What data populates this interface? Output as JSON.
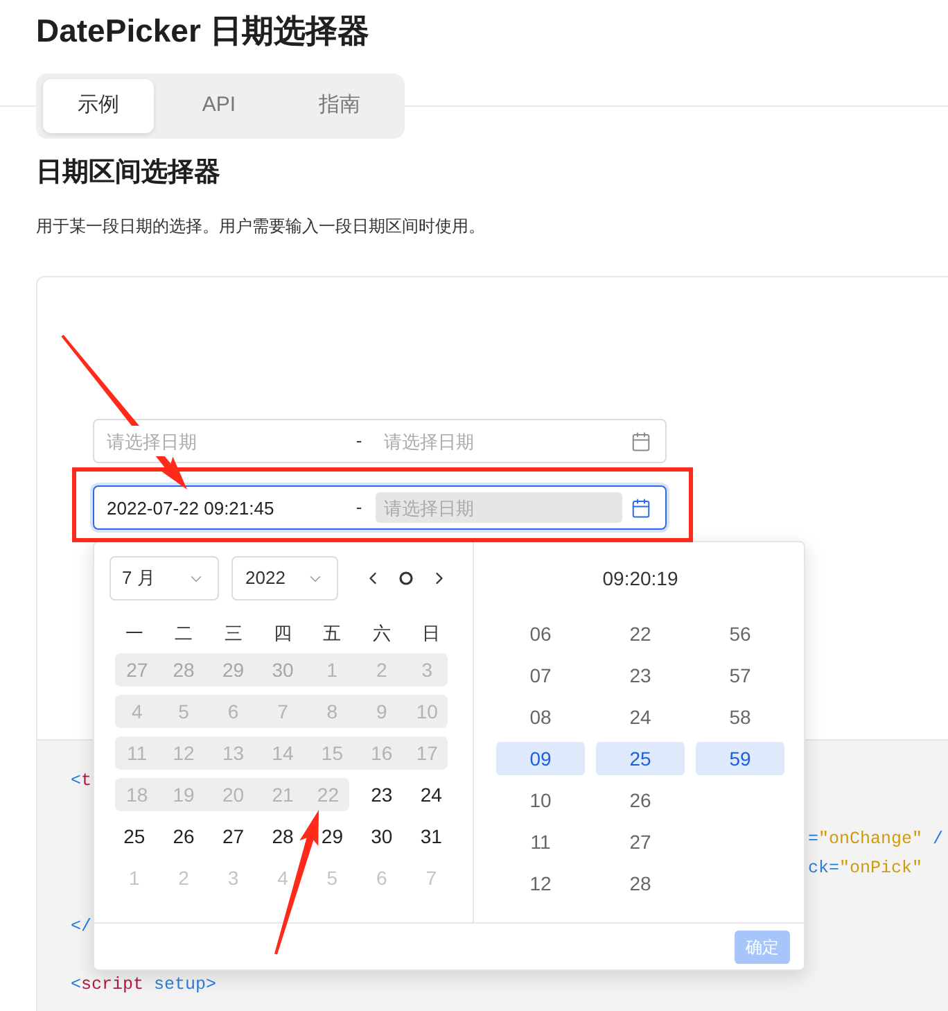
{
  "page": {
    "title": "DatePicker 日期选择器"
  },
  "tabs": [
    {
      "label": "示例",
      "selected": true
    },
    {
      "label": "API",
      "selected": false
    },
    {
      "label": "指南",
      "selected": false
    }
  ],
  "section": {
    "heading": "日期区间选择器",
    "description": "用于某一段日期的选择。用户需要输入一段日期区间时使用。"
  },
  "demo": {
    "range_pickers": [
      {
        "start": {
          "placeholder": "请选择日期",
          "active": false
        },
        "separator": "-",
        "end": {
          "placeholder": "请选择日期",
          "active": false
        },
        "focused": false,
        "highlighted": false
      },
      {
        "start": {
          "value": "2022-07-22 09:21:45",
          "active": false
        },
        "separator": "-",
        "end": {
          "placeholder": "请选择日期",
          "active": true
        },
        "focused": true,
        "highlighted": true
      }
    ],
    "popup": {
      "month_select": {
        "value": "7 月"
      },
      "year_select": {
        "value": "2022"
      },
      "weekdays": [
        "一",
        "二",
        "三",
        "四",
        "五",
        "六",
        "日"
      ],
      "weeks": [
        {
          "days": [
            {
              "label": "27",
              "disabled": true,
              "other_month": true
            },
            {
              "label": "28",
              "disabled": true,
              "other_month": true
            },
            {
              "label": "29",
              "disabled": true,
              "other_month": true
            },
            {
              "label": "30",
              "disabled": true,
              "other_month": true
            },
            {
              "label": "1",
              "disabled": true,
              "other_month": false
            },
            {
              "label": "2",
              "disabled": true,
              "other_month": false
            },
            {
              "label": "3",
              "disabled": true,
              "other_month": false
            }
          ]
        },
        {
          "days": [
            {
              "label": "4",
              "disabled": true,
              "other_month": false
            },
            {
              "label": "5",
              "disabled": true,
              "other_month": false
            },
            {
              "label": "6",
              "disabled": true,
              "other_month": false
            },
            {
              "label": "7",
              "disabled": true,
              "other_month": false
            },
            {
              "label": "8",
              "disabled": true,
              "other_month": false
            },
            {
              "label": "9",
              "disabled": true,
              "other_month": false
            },
            {
              "label": "10",
              "disabled": true,
              "other_month": false
            }
          ]
        },
        {
          "days": [
            {
              "label": "11",
              "disabled": true,
              "other_month": false
            },
            {
              "label": "12",
              "disabled": true,
              "other_month": false
            },
            {
              "label": "13",
              "disabled": true,
              "other_month": false
            },
            {
              "label": "14",
              "disabled": true,
              "other_month": false
            },
            {
              "label": "15",
              "disabled": true,
              "other_month": false
            },
            {
              "label": "16",
              "disabled": true,
              "other_month": false
            },
            {
              "label": "17",
              "disabled": true,
              "other_month": false
            }
          ]
        },
        {
          "days": [
            {
              "label": "18",
              "disabled": true,
              "other_month": false
            },
            {
              "label": "19",
              "disabled": true,
              "other_month": false
            },
            {
              "label": "20",
              "disabled": true,
              "other_month": false
            },
            {
              "label": "21",
              "disabled": true,
              "other_month": false
            },
            {
              "label": "22",
              "disabled": true,
              "other_month": false
            },
            {
              "label": "23",
              "disabled": false,
              "other_month": false
            },
            {
              "label": "24",
              "disabled": false,
              "other_month": false
            }
          ]
        },
        {
          "days": [
            {
              "label": "25",
              "disabled": false,
              "other_month": false
            },
            {
              "label": "26",
              "disabled": false,
              "other_month": false
            },
            {
              "label": "27",
              "disabled": false,
              "other_month": false
            },
            {
              "label": "28",
              "disabled": false,
              "other_month": false
            },
            {
              "label": "29",
              "disabled": false,
              "other_month": false
            },
            {
              "label": "30",
              "disabled": false,
              "other_month": false
            },
            {
              "label": "31",
              "disabled": false,
              "other_month": false
            }
          ]
        },
        {
          "days": [
            {
              "label": "1",
              "disabled": false,
              "other_month": true
            },
            {
              "label": "2",
              "disabled": false,
              "other_month": true
            },
            {
              "label": "3",
              "disabled": false,
              "other_month": true
            },
            {
              "label": "4",
              "disabled": false,
              "other_month": true
            },
            {
              "label": "5",
              "disabled": false,
              "other_month": true
            },
            {
              "label": "6",
              "disabled": false,
              "other_month": true
            },
            {
              "label": "7",
              "disabled": false,
              "other_month": true
            }
          ]
        }
      ],
      "time_panel": {
        "title": "09:20:19",
        "columns": [
          {
            "items": [
              {
                "label": "06",
                "selected": false
              },
              {
                "label": "07",
                "selected": false
              },
              {
                "label": "08",
                "selected": false
              },
              {
                "label": "09",
                "selected": true
              },
              {
                "label": "10",
                "selected": false
              },
              {
                "label": "11",
                "selected": false
              },
              {
                "label": "12",
                "selected": false
              }
            ]
          },
          {
            "items": [
              {
                "label": "22",
                "selected": false
              },
              {
                "label": "23",
                "selected": false
              },
              {
                "label": "24",
                "selected": false
              },
              {
                "label": "25",
                "selected": true
              },
              {
                "label": "26",
                "selected": false
              },
              {
                "label": "27",
                "selected": false
              },
              {
                "label": "28",
                "selected": false
              }
            ]
          },
          {
            "items": [
              {
                "label": "56",
                "selected": false
              },
              {
                "label": "57",
                "selected": false
              },
              {
                "label": "58",
                "selected": false
              },
              {
                "label": "59",
                "selected": true
              }
            ]
          }
        ]
      },
      "confirm_button": {
        "label": "确定",
        "disabled": true
      }
    }
  },
  "code": {
    "lines": [
      {
        "kind": "left_fragment",
        "tokens": [
          {
            "kind": "punct",
            "text": "<"
          },
          {
            "kind": "tag",
            "text": "t"
          }
        ]
      },
      {
        "kind": "right_fragment",
        "tokens": [
          {
            "kind": "punct",
            "text": "="
          },
          {
            "kind": "string",
            "text": "\"onChange\""
          },
          {
            "kind": "punct",
            "text": " /"
          }
        ]
      },
      {
        "kind": "right_fragment",
        "tokens": [
          {
            "kind": "attr",
            "text": "ck="
          },
          {
            "kind": "string",
            "text": "\"onPick\""
          }
        ]
      },
      {
        "kind": "left_fragment",
        "tokens": [
          {
            "kind": "punct",
            "text": "</"
          }
        ]
      },
      {
        "kind": "full",
        "tokens": [
          {
            "kind": "punct",
            "text": "<"
          },
          {
            "kind": "tag",
            "text": "script"
          },
          {
            "kind": "attr",
            "text": " setup"
          },
          {
            "kind": "punct",
            "text": ">"
          }
        ]
      }
    ]
  }
}
